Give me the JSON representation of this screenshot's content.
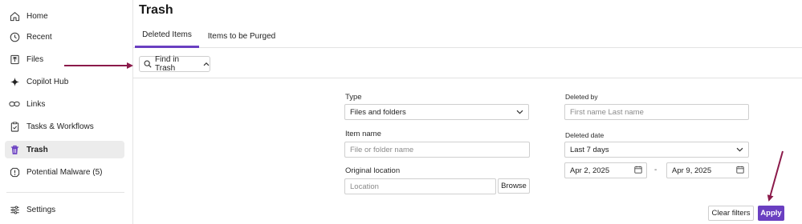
{
  "sidebar": {
    "items": [
      {
        "label": "Home",
        "icon": "home-icon"
      },
      {
        "label": "Recent",
        "icon": "clock-icon"
      },
      {
        "label": "Files",
        "icon": "files-icon"
      },
      {
        "label": "Copilot Hub",
        "icon": "sparkle-icon"
      },
      {
        "label": "Links",
        "icon": "link-icon"
      },
      {
        "label": "Tasks & Workflows",
        "icon": "tasks-icon"
      },
      {
        "label": "Trash",
        "icon": "trash-icon",
        "active": true
      },
      {
        "label": "Potential Malware (5)",
        "icon": "warning-icon"
      },
      {
        "label": "Settings",
        "icon": "settings-icon"
      }
    ]
  },
  "page": {
    "title": "Trash"
  },
  "tabs": [
    {
      "label": "Deleted Items",
      "active": true
    },
    {
      "label": "Items to be Purged",
      "active": false
    }
  ],
  "find": {
    "label": "Find in Trash"
  },
  "filters": {
    "type": {
      "label": "Type",
      "value": "Files and folders"
    },
    "item_name": {
      "label": "Item name",
      "placeholder": "File or folder name"
    },
    "original_location": {
      "label": "Original location",
      "placeholder": "Location",
      "browse_label": "Browse"
    },
    "deleted_by": {
      "label": "Deleted by",
      "placeholder": "First name Last name"
    },
    "deleted_date": {
      "label": "Deleted date",
      "value": "Last 7 days",
      "from": "Apr 2, 2025",
      "to": "Apr 9, 2025",
      "separator": "-"
    }
  },
  "actions": {
    "clear_label": "Clear filters",
    "apply_label": "Apply"
  },
  "colors": {
    "accent": "#6a3fc1",
    "annotation_arrow": "#8b1a4a"
  }
}
